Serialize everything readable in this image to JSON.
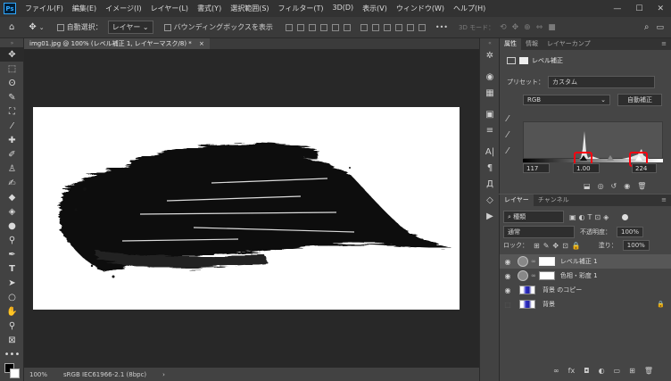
{
  "app": {
    "logo": "Ps"
  },
  "menu": [
    "ファイル(F)",
    "編集(E)",
    "イメージ(I)",
    "レイヤー(L)",
    "書式(Y)",
    "選択範囲(S)",
    "フィルター(T)",
    "3D(D)",
    "表示(V)",
    "ウィンドウ(W)",
    "ヘルプ(H)"
  ],
  "window_controls": [
    "—",
    "☐",
    "✕"
  ],
  "options": {
    "auto_select_label": "自動選択：",
    "auto_select_value": "レイヤー",
    "bbox_label": "バウンディングボックスを表示",
    "more": "•••",
    "mode_3d": "3D モード："
  },
  "document": {
    "tab_title": "img01.jpg @ 100% (レベル補正 1, レイヤーマスク/8) *",
    "close": "×",
    "zoom": "100%",
    "color_profile": "sRGB IEC61966-2.1 (8bpc)",
    "status_arrow": "›"
  },
  "properties": {
    "tabs": [
      "属性",
      "情報",
      "レイヤーカンプ"
    ],
    "title": "レベル補正",
    "preset_label": "プリセット：",
    "preset_value": "カスタム",
    "channel": "RGB",
    "auto_button": "自動補正",
    "input_black": "117",
    "input_gamma": "1.00",
    "input_white": "224"
  },
  "layers": {
    "tabs": [
      "レイヤー",
      "チャンネル"
    ],
    "filter_kind": "種類",
    "blend_mode": "通常",
    "opacity_label": "不透明度：",
    "opacity_value": "100%",
    "lock_label": "ロック：",
    "fill_label": "塗り：",
    "fill_value": "100%",
    "items": [
      {
        "name": "レベル補正 1"
      },
      {
        "name": "色相・彩度 1"
      },
      {
        "name": "背景 のコピー"
      },
      {
        "name": "背景"
      }
    ]
  }
}
